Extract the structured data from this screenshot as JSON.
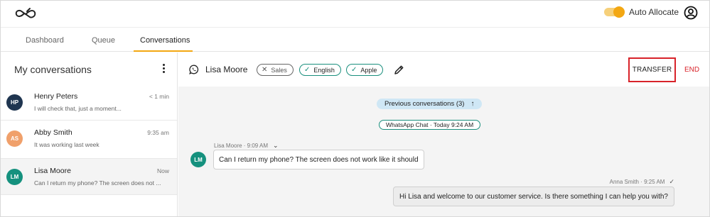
{
  "topbar": {
    "logo_icon": "infinity-logo",
    "auto_allocate_label": "Auto Allocate",
    "auto_allocate_on": true,
    "user_icon": "user-account-icon"
  },
  "tabs": [
    {
      "label": "Dashboard",
      "active": false
    },
    {
      "label": "Queue",
      "active": false
    },
    {
      "label": "Conversations",
      "active": true
    }
  ],
  "sidebar": {
    "title": "My conversations",
    "conversations": [
      {
        "initials": "HP",
        "name": "Henry Peters",
        "time": "< 1 min",
        "preview": "I will check that, just a moment...",
        "avatar_color": "#1f3550",
        "selected": false
      },
      {
        "initials": "AS",
        "name": "Abby Smith",
        "time": "9:35 am",
        "preview": "It was working last week",
        "avatar_color": "#f0a06b",
        "selected": false
      },
      {
        "initials": "LM",
        "name": "Lisa Moore",
        "time": "Now",
        "preview": "Can I return my phone? The screen does not ...",
        "avatar_color": "#15917e",
        "selected": true
      }
    ]
  },
  "chat_header": {
    "channel_icon": "whatsapp-icon",
    "contact_name": "Lisa Moore",
    "tags": [
      {
        "label": "Sales",
        "state": "removed",
        "icon": "x-icon"
      },
      {
        "label": "English",
        "state": "confirmed",
        "icon": "check-icon"
      },
      {
        "label": "Apple",
        "state": "confirmed",
        "icon": "check-icon"
      }
    ],
    "edit_icon": "pencil-icon",
    "transfer_label": "TRANSFER",
    "end_label": "END"
  },
  "chat": {
    "previous_conversations": "Previous conversations (3)",
    "channel_pill": "WhatsApp Chat · Today 9:24 AM",
    "messages": [
      {
        "direction": "in",
        "meta": "Lisa Moore · 9:09 AM",
        "text": "Can I return my phone? The screen does not work like it should",
        "avatar": "LM"
      },
      {
        "direction": "out",
        "meta": "Anna Smith · 9:25 AM",
        "text": "Hi Lisa and welcome to our customer service. Is there something I can help you with?"
      }
    ]
  },
  "colors": {
    "accent": "#f3a712",
    "teal": "#15917e",
    "danger": "#d8232a",
    "pill_blue": "#cfe7f5"
  }
}
